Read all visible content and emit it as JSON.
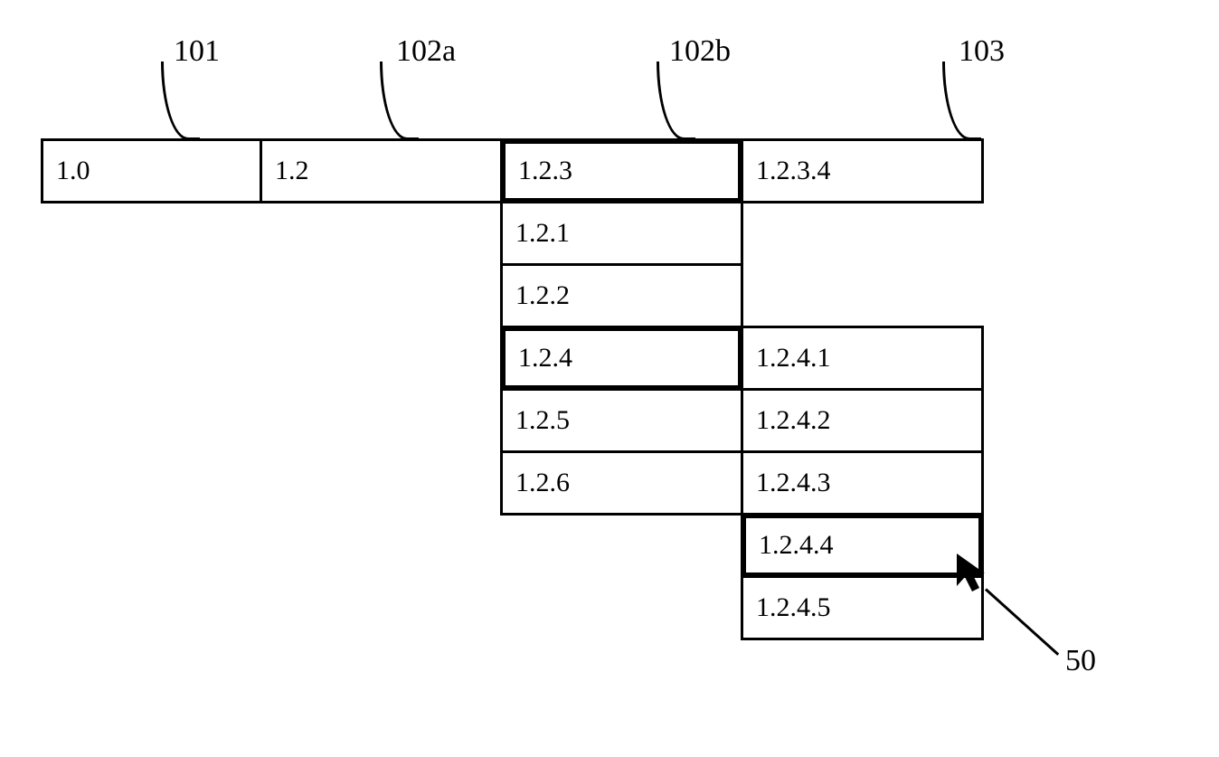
{
  "columnLabels": {
    "c101": "101",
    "c102a": "102a",
    "c102b": "102b",
    "c103": "103"
  },
  "cells": {
    "colA_r0": "1.0",
    "colB_r0": "1.2",
    "colC_r0": "1.2.3",
    "colC_r1": "1.2.1",
    "colC_r2": "1.2.2",
    "colC_r3": "1.2.4",
    "colC_r4": "1.2.5",
    "colC_r5": "1.2.6",
    "colD_r0": "1.2.3.4",
    "colD_r3": "1.2.4.1",
    "colD_r4": "1.2.4.2",
    "colD_r5": "1.2.4.3",
    "colD_r6": "1.2.4.4",
    "colD_r7": "1.2.4.5"
  },
  "callout": {
    "label": "50"
  }
}
